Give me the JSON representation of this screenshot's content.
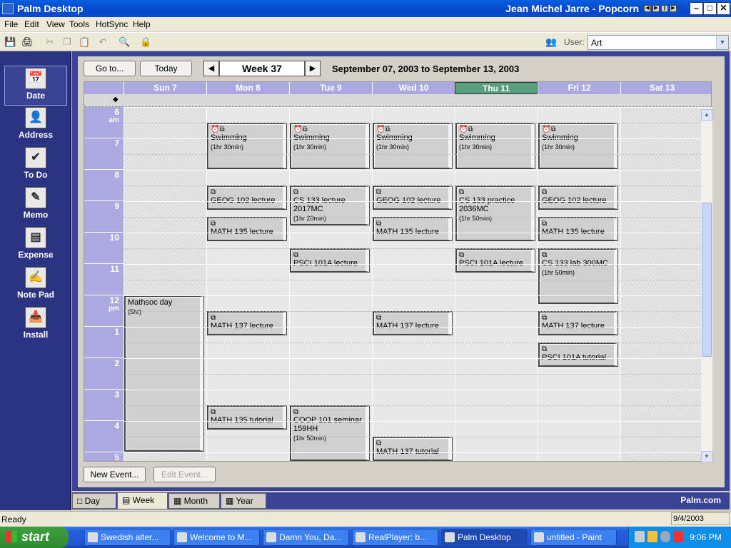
{
  "window": {
    "title": "Palm Desktop",
    "now_playing": "Jean Michel Jarre - Popcorn",
    "controls": [
      "–",
      "□",
      "✕"
    ]
  },
  "menu": [
    "File",
    "Edit",
    "View",
    "Tools",
    "HotSync",
    "Help"
  ],
  "toolbar": {
    "user_label": "User:",
    "user_value": "Art"
  },
  "nav": [
    {
      "label": "Date",
      "icon": "calendar-icon"
    },
    {
      "label": "Address",
      "icon": "address-card-icon"
    },
    {
      "label": "To Do",
      "icon": "checklist-icon"
    },
    {
      "label": "Memo",
      "icon": "memo-icon"
    },
    {
      "label": "Expense",
      "icon": "expense-icon"
    },
    {
      "label": "Note Pad",
      "icon": "notepad-icon"
    },
    {
      "label": "Install",
      "icon": "install-icon"
    }
  ],
  "controls": {
    "goto": "Go to...",
    "today": "Today",
    "week": "Week 37",
    "range": "September 07, 2003 to September 13, 2003",
    "new_event": "New Event...",
    "edit_event": "Edit Event..."
  },
  "days": [
    "Sun 7",
    "Mon 8",
    "Tue 9",
    "Wed 10",
    "Thu 11",
    "Fri 12",
    "Sat 13"
  ],
  "allday_marker": "◆",
  "hours": [
    {
      "h": "6",
      "ap": "am"
    },
    {
      "h": "7",
      "ap": ""
    },
    {
      "h": "8",
      "ap": ""
    },
    {
      "h": "9",
      "ap": ""
    },
    {
      "h": "10",
      "ap": ""
    },
    {
      "h": "11",
      "ap": ""
    },
    {
      "h": "12",
      "ap": "pm"
    },
    {
      "h": "1",
      "ap": ""
    },
    {
      "h": "2",
      "ap": ""
    },
    {
      "h": "3",
      "ap": ""
    },
    {
      "h": "4",
      "ap": ""
    },
    {
      "h": "5",
      "ap": ""
    }
  ],
  "events": [
    {
      "day": 1,
      "title": "Swimming",
      "dur": "(1hr 30min)",
      "start": 6.5,
      "len": 1.5,
      "alarm": true
    },
    {
      "day": 2,
      "title": "Swimming",
      "dur": "(1hr 30min)",
      "start": 6.5,
      "len": 1.5,
      "alarm": true
    },
    {
      "day": 3,
      "title": "Swimming",
      "dur": "(1hr 30min)",
      "start": 6.5,
      "len": 1.5,
      "alarm": true
    },
    {
      "day": 4,
      "title": "Swimming",
      "dur": "(1hr 30min)",
      "start": 6.5,
      "len": 1.5,
      "alarm": true
    },
    {
      "day": 5,
      "title": "Swimming",
      "dur": "(1hr 30min)",
      "start": 6.5,
      "len": 1.5,
      "alarm": true
    },
    {
      "day": 1,
      "title": "GEOG 102 lecture",
      "dur": "",
      "start": 8.5,
      "len": 0.8
    },
    {
      "day": 2,
      "title": "CS 133 lecture 2017MC",
      "dur": "(1hr 20min)",
      "start": 8.5,
      "len": 1.3
    },
    {
      "day": 3,
      "title": "GEOG 102 lecture",
      "dur": "",
      "start": 8.5,
      "len": 0.8
    },
    {
      "day": 4,
      "title": "CS 133 practice 2036MC",
      "dur": "(1hr 50min)",
      "start": 8.5,
      "len": 1.8
    },
    {
      "day": 5,
      "title": "GEOG 102 lecture",
      "dur": "",
      "start": 8.5,
      "len": 0.8
    },
    {
      "day": 1,
      "title": "MATH 135 lecture",
      "dur": "",
      "start": 9.5,
      "len": 0.8
    },
    {
      "day": 3,
      "title": "MATH 135 lecture",
      "dur": "",
      "start": 9.5,
      "len": 0.8
    },
    {
      "day": 5,
      "title": "MATH 135 lecture",
      "dur": "",
      "start": 9.5,
      "len": 0.8
    },
    {
      "day": 2,
      "title": "PSCI 101A lecture",
      "dur": "",
      "start": 10.5,
      "len": 0.8
    },
    {
      "day": 4,
      "title": "PSCI 101A lecture",
      "dur": "",
      "start": 10.5,
      "len": 0.8
    },
    {
      "day": 5,
      "title": "CS 133 lab 300MC",
      "dur": "(1hr 50min)",
      "start": 10.5,
      "len": 1.8
    },
    {
      "day": 0,
      "title": "Mathsoc day",
      "dur": "(5hr)",
      "start": 12,
      "len": 5,
      "noicon": true
    },
    {
      "day": 1,
      "title": "MATH 137 lecture",
      "dur": "",
      "start": 12.5,
      "len": 0.8
    },
    {
      "day": 3,
      "title": "MATH 137 lecture",
      "dur": "",
      "start": 12.5,
      "len": 0.8
    },
    {
      "day": 5,
      "title": "MATH 137 lecture",
      "dur": "",
      "start": 12.5,
      "len": 0.8
    },
    {
      "day": 5,
      "title": "PSCI 101A tutorial",
      "dur": "",
      "start": 13.5,
      "len": 0.8
    },
    {
      "day": 1,
      "title": "MATH 135 tutorial",
      "dur": "",
      "start": 15.5,
      "len": 0.8
    },
    {
      "day": 2,
      "title": "COOP 101 seminar 159HH",
      "dur": "(1hr 50min)",
      "start": 15.5,
      "len": 1.8
    },
    {
      "day": 3,
      "title": "MATH 137 tutorial",
      "dur": "",
      "start": 16.5,
      "len": 0.8
    }
  ],
  "tabs": [
    "Day",
    "Week",
    "Month",
    "Year"
  ],
  "brand": "Palm.com",
  "status": {
    "text": "Ready",
    "date": "9/4/2003"
  },
  "taskbar": {
    "start": "start",
    "tasks": [
      "Swedish alter...",
      "Welcome to M...",
      "Damn You, Da...",
      "RealPlayer: b...",
      "Palm Desktop",
      "untitled - Paint"
    ],
    "time": "9:06 PM"
  }
}
